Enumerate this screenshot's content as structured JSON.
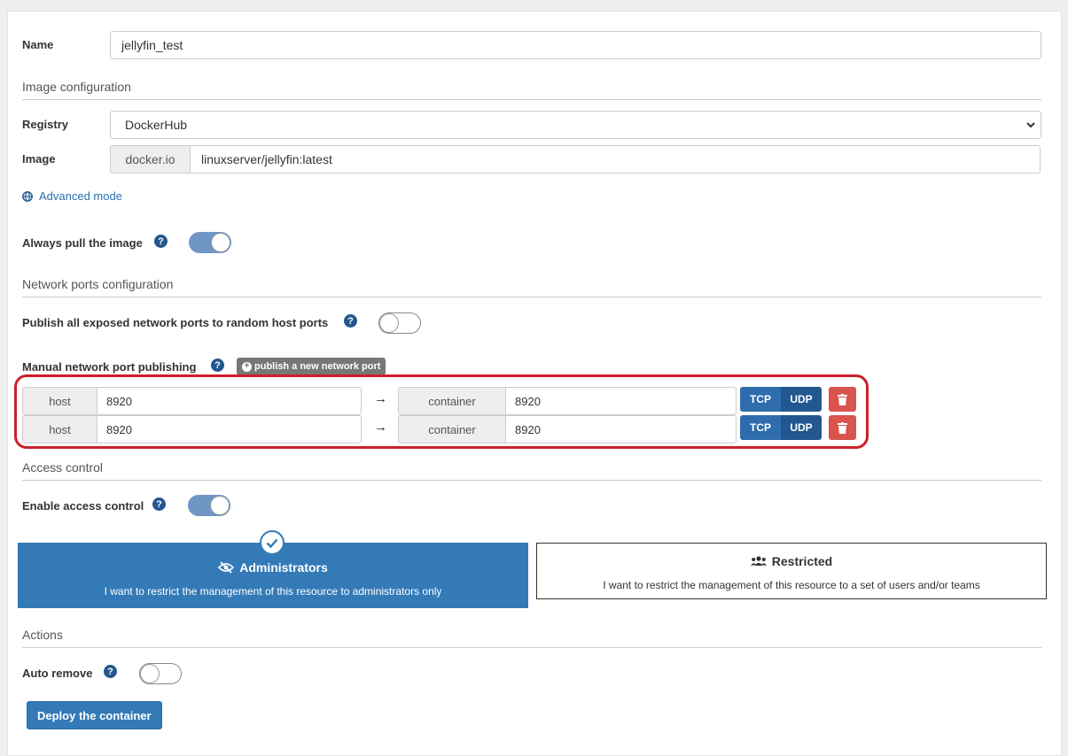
{
  "form": {
    "name_label": "Name",
    "name_value": "jellyfin_test"
  },
  "image_config": {
    "section_title": "Image configuration",
    "registry_label": "Registry",
    "registry_value": "DockerHub",
    "image_label": "Image",
    "image_prefix": "docker.io",
    "image_value": "linuxserver/jellyfin:latest",
    "advanced_link": "Advanced mode",
    "always_pull_label": "Always pull the image",
    "always_pull_on": true
  },
  "network": {
    "section_title": "Network ports configuration",
    "publish_all_label": "Publish all exposed network ports to random host ports",
    "publish_all_on": false,
    "manual_label": "Manual network port publishing",
    "publish_new_button": "publish a new network port",
    "ports": [
      {
        "host_label": "host",
        "host_value": "8920",
        "container_label": "container",
        "container_value": "8920",
        "tcp": "TCP",
        "udp": "UDP"
      },
      {
        "host_label": "host",
        "host_value": "8920",
        "container_label": "container",
        "container_value": "8920",
        "tcp": "TCP",
        "udp": "UDP"
      }
    ],
    "highlight_color": "#cc1f2a"
  },
  "access": {
    "section_title": "Access control",
    "enable_label": "Enable access control",
    "enable_on": true,
    "admin_title": "Administrators",
    "admin_desc": "I want to restrict the management of this resource to administrators only",
    "restricted_title": "Restricted",
    "restricted_desc": "I want to restrict the management of this resource to a set of users and/or teams",
    "selected": "Administrators"
  },
  "actions": {
    "section_title": "Actions",
    "auto_remove_label": "Auto remove",
    "auto_remove_on": false,
    "deploy_button": "Deploy the container"
  },
  "colors": {
    "primary": "#337ab7",
    "help_icon": "#23578f",
    "danger": "#d9534f"
  }
}
